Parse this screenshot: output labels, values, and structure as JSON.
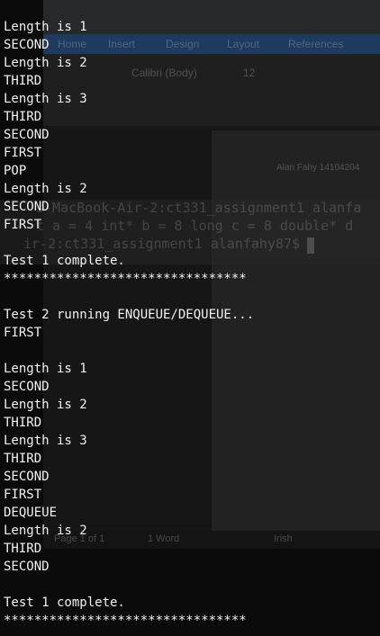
{
  "background_window": {
    "ribbon_tabs": [
      "Home",
      "Insert",
      "Design",
      "Layout",
      "References"
    ],
    "font_name": "Calibri (Body)",
    "font_size": "12",
    "doc_author_line": "Alan Fahy 14104204",
    "status_page": "Page 1 of 1",
    "status_words": "1 Word",
    "status_language": "Irish",
    "ghost_terminal_lines": [
      "s-MacBook-Air-2:ct331_assignment1 alanfa",
      "t a =  4 int* b =  8 long c =  8 double* d",
      "ir-2:ct331_assignment1 alanfahy87$"
    ]
  },
  "terminal": {
    "lines": [
      "Length is 1",
      "SECOND",
      "Length is 2",
      "THIRD",
      "Length is 3",
      "THIRD",
      "SECOND",
      "FIRST",
      "POP",
      "Length is 2",
      "SECOND",
      "FIRST",
      "",
      "Test 1 complete.",
      "********************************",
      "",
      "Test 2 running ENQUEUE/DEQUEUE...",
      "FIRST",
      "",
      "Length is 1",
      "SECOND",
      "Length is 2",
      "THIRD",
      "Length is 3",
      "THIRD",
      "SECOND",
      "FIRST",
      "DEQUEUE",
      "Length is 2",
      "THIRD",
      "SECOND",
      "",
      "Test 1 complete.",
      "********************************"
    ]
  },
  "colors": {
    "terminal_text": "#f2f2f2",
    "terminal_bg": "#0b0b0b",
    "ribbon_tab_bar": "#1e3a5f"
  }
}
